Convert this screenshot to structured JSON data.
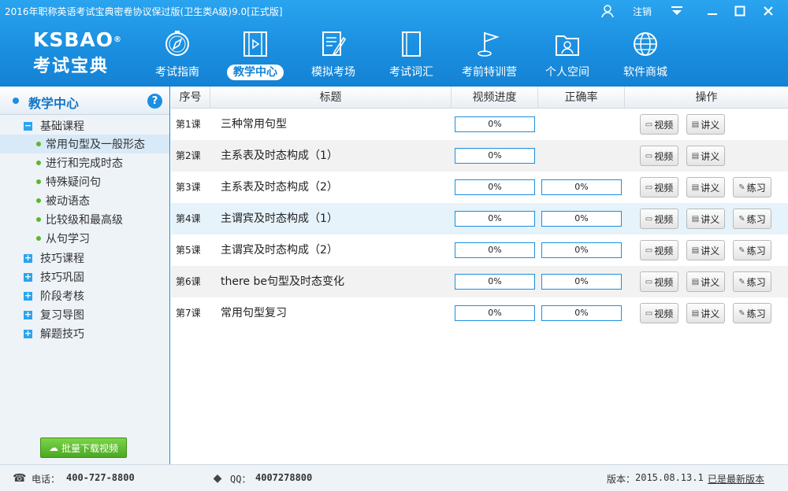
{
  "window": {
    "title": "2016年职称英语考试宝典密卷协议保过版(卫生类A级)9.0[正式版]",
    "logout": "注销"
  },
  "logo": {
    "en": "KSBAO",
    "reg": "®",
    "cn": "考试宝典"
  },
  "nav": [
    {
      "label": "考试指南",
      "icon": "compass-icon"
    },
    {
      "label": "教学中心",
      "icon": "video-film-icon",
      "active": true
    },
    {
      "label": "模拟考场",
      "icon": "exam-paper-icon"
    },
    {
      "label": "考试词汇",
      "icon": "book-icon"
    },
    {
      "label": "考前特训营",
      "icon": "flag-icon"
    },
    {
      "label": "个人空间",
      "icon": "person-folder-icon"
    },
    {
      "label": "软件商城",
      "icon": "globe-icon"
    }
  ],
  "sidebar": {
    "title": "教学中心",
    "help": "?",
    "categories": [
      {
        "label": "基础课程",
        "expanded": true
      },
      {
        "label": "技巧课程"
      },
      {
        "label": "技巧巩固"
      },
      {
        "label": "阶段考核"
      },
      {
        "label": "复习导图"
      },
      {
        "label": "解题技巧"
      }
    ],
    "leaves": [
      {
        "label": "常用句型及一般形态",
        "selected": true
      },
      {
        "label": "进行和完成时态"
      },
      {
        "label": "特殊疑问句"
      },
      {
        "label": "被动语态"
      },
      {
        "label": "比较级和最高级"
      },
      {
        "label": "从句学习"
      }
    ],
    "download_label": "批量下载视频"
  },
  "table": {
    "headers": [
      "序号",
      "标题",
      "视频进度",
      "正确率",
      "操作"
    ],
    "buttons": {
      "video": "视频",
      "handout": "讲义",
      "practice": "练习"
    },
    "rows": [
      {
        "no": "第1课",
        "title": "三种常用句型",
        "progress": "0%",
        "accuracy": null,
        "practice": false
      },
      {
        "no": "第2课",
        "title": "主系表及时态构成（1）",
        "progress": "0%",
        "accuracy": null,
        "practice": false
      },
      {
        "no": "第3课",
        "title": "主系表及时态构成（2）",
        "progress": "0%",
        "accuracy": "0%",
        "practice": true
      },
      {
        "no": "第4课",
        "title": "主谓宾及时态构成（1）",
        "progress": "0%",
        "accuracy": "0%",
        "practice": true
      },
      {
        "no": "第5课",
        "title": "主谓宾及时态构成（2）",
        "progress": "0%",
        "accuracy": "0%",
        "practice": true
      },
      {
        "no": "第6课",
        "title": "there be句型及时态变化",
        "progress": "0%",
        "accuracy": "0%",
        "practice": true
      },
      {
        "no": "第7课",
        "title": "常用句型复习",
        "progress": "0%",
        "accuracy": "0%",
        "practice": true
      }
    ]
  },
  "footer": {
    "phone_label": "电话：",
    "phone": "400-727-8800",
    "qq_label": "QQ：",
    "qq": "4007278800",
    "version_label": "版本：",
    "version": "2015.08.13.1",
    "update_status": "已是最新版本"
  },
  "colors": {
    "primary": "#1b8fe0",
    "accent_green": "#4aa822"
  }
}
